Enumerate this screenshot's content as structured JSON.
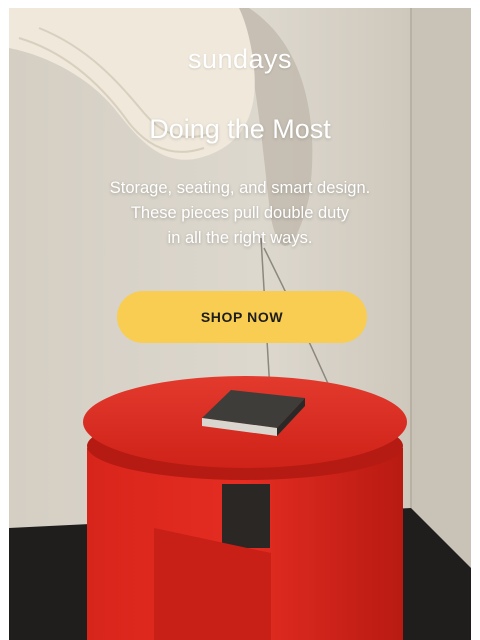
{
  "brand": {
    "logo_text": "sundays"
  },
  "hero": {
    "headline": "Doing the Most",
    "body_lines": [
      "Storage, seating, and smart design.",
      "These pieces pull double duty",
      "in all the right ways."
    ],
    "cta_label": "SHOP NOW"
  },
  "colors": {
    "cta_background": "#f8cd52",
    "table_red": "#e0281e",
    "wall": "#d9d3c8",
    "floor": "#1f1e1c"
  }
}
